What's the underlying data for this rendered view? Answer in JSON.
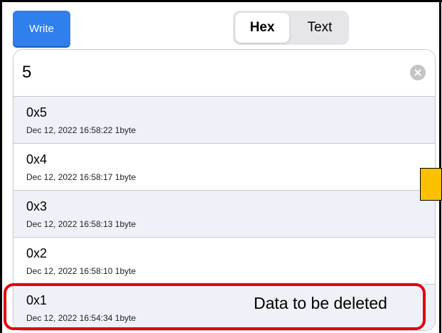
{
  "toolbar": {
    "write_label": "Write"
  },
  "mode": {
    "options": [
      "Hex",
      "Text"
    ],
    "selected": "Hex"
  },
  "search": {
    "value": "5",
    "clear_icon": "clear-circle-icon"
  },
  "history": [
    {
      "value": "0x5",
      "meta": "Dec 12, 2022 16:58:22  1byte"
    },
    {
      "value": "0x4",
      "meta": "Dec 12, 2022 16:58:17  1byte"
    },
    {
      "value": "0x3",
      "meta": "Dec 12, 2022 16:58:13  1byte"
    },
    {
      "value": "0x2",
      "meta": "Dec 12, 2022 16:58:10  1byte"
    },
    {
      "value": "0x1",
      "meta": "Dec 12, 2022 16:54:34  1byte"
    }
  ],
  "annotation": {
    "label": "Data to be deleted",
    "highlight_color": "#e3000f",
    "marker_color": "#fcc000"
  },
  "colors": {
    "accent": "#2f80ed",
    "row_alt": "#eef2f8"
  }
}
